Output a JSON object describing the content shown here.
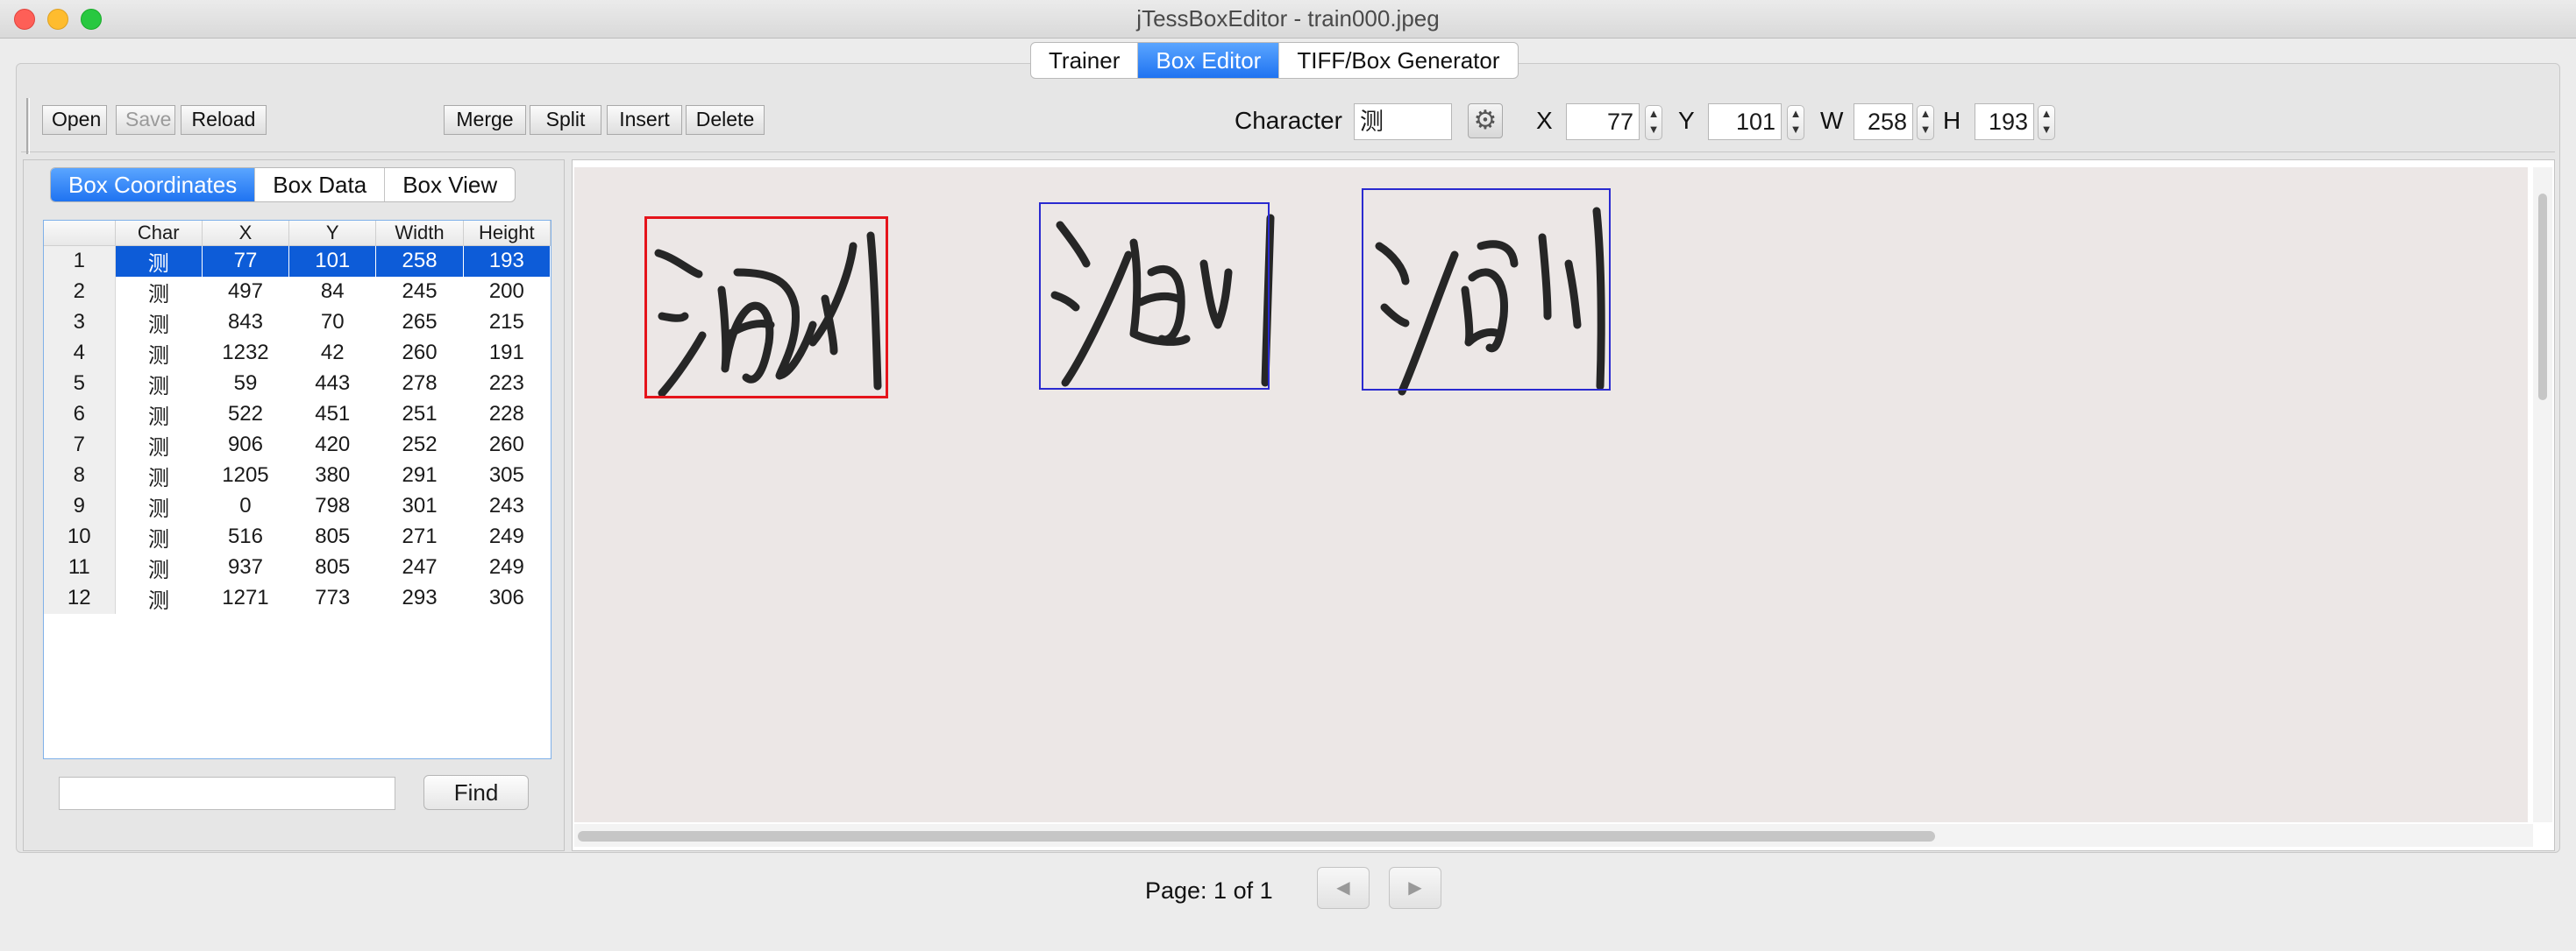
{
  "window": {
    "title": "jTessBoxEditor - train000.jpeg"
  },
  "top_tabs": [
    {
      "label": "Trainer",
      "active": false
    },
    {
      "label": "Box Editor",
      "active": true
    },
    {
      "label": "TIFF/Box Generator",
      "active": false
    }
  ],
  "toolbar": {
    "open_label": "Open",
    "save_label": "Save",
    "reload_label": "Reload",
    "merge_label": "Merge",
    "split_label": "Split",
    "insert_label": "Insert",
    "delete_label": "Delete",
    "character_label": "Character",
    "character_value": "测",
    "x_label": "X",
    "x_value": "77",
    "y_label": "Y",
    "y_value": "101",
    "w_label": "W",
    "w_value": "258",
    "h_label": "H",
    "h_value": "193"
  },
  "left_tabs": [
    {
      "label": "Box Coordinates",
      "active": true
    },
    {
      "label": "Box Data",
      "active": false
    },
    {
      "label": "Box View",
      "active": false
    }
  ],
  "table": {
    "headers": [
      "",
      "Char",
      "X",
      "Y",
      "Width",
      "Height"
    ],
    "rows": [
      [
        "1",
        "测",
        "77",
        "101",
        "258",
        "193"
      ],
      [
        "2",
        "测",
        "497",
        "84",
        "245",
        "200"
      ],
      [
        "3",
        "测",
        "843",
        "70",
        "265",
        "215"
      ],
      [
        "4",
        "测",
        "1232",
        "42",
        "260",
        "191"
      ],
      [
        "5",
        "测",
        "59",
        "443",
        "278",
        "223"
      ],
      [
        "6",
        "测",
        "522",
        "451",
        "251",
        "228"
      ],
      [
        "7",
        "测",
        "906",
        "420",
        "252",
        "260"
      ],
      [
        "8",
        "测",
        "1205",
        "380",
        "291",
        "305"
      ],
      [
        "9",
        "测",
        "0",
        "798",
        "301",
        "243"
      ],
      [
        "10",
        "测",
        "516",
        "805",
        "271",
        "249"
      ],
      [
        "11",
        "测",
        "937",
        "805",
        "247",
        "249"
      ],
      [
        "12",
        "测",
        "1271",
        "773",
        "293",
        "306"
      ]
    ],
    "selected_row": 1
  },
  "find": {
    "input_value": "",
    "button_label": "Find"
  },
  "pager": {
    "label": "Page: 1 of 1"
  },
  "colors": {
    "accent": "#1f73f1",
    "selected_box": "#e5141b",
    "box": "#2a2ad0",
    "paper": "#ece7e6"
  },
  "icons": [
    "gear-icon",
    "chevron-up-down-icon",
    "prev-page-icon",
    "next-page-icon"
  ]
}
